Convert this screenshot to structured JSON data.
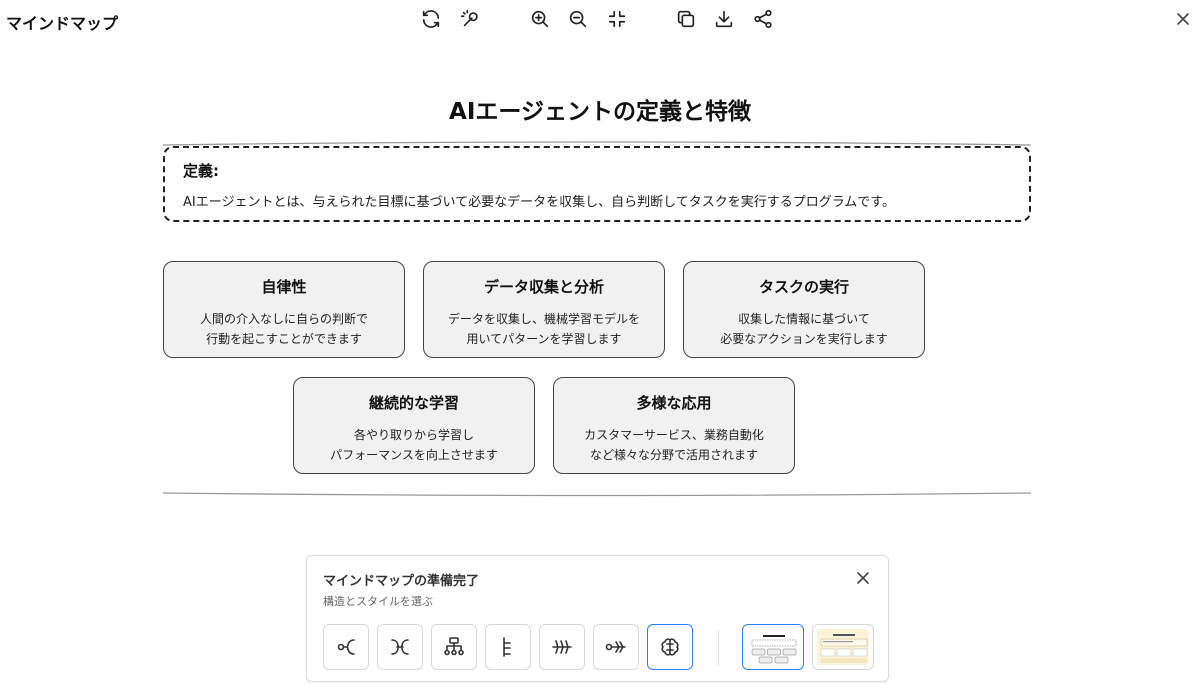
{
  "app": {
    "title": "マインドマップ"
  },
  "toolbar": {
    "icons": [
      "refresh-icon",
      "magic-wand-icon",
      "zoom-in-icon",
      "zoom-out-icon",
      "collapse-icon",
      "copy-icon",
      "download-icon",
      "share-icon"
    ]
  },
  "mindmap": {
    "title": "AIエージェントの定義と特徴",
    "definition": {
      "label": "定義:",
      "text": "AIエージェントとは、与えられた目標に基づいて必要なデータを収集し、自ら判断してタスクを実行するプログラムです。"
    },
    "cards": [
      {
        "title": "自律性",
        "lines": [
          "人間の介入なしに自らの判断で",
          "行動を起こすことができます"
        ]
      },
      {
        "title": "データ収集と分析",
        "lines": [
          "データを収集し、機械学習モデルを",
          "用いてパターンを学習します"
        ]
      },
      {
        "title": "タスクの実行",
        "lines": [
          "収集した情報に基づいて",
          "必要なアクションを実行します"
        ]
      },
      {
        "title": "継続的な学習",
        "lines": [
          "各やり取りから学習し",
          "パフォーマンスを向上させます"
        ]
      },
      {
        "title": "多様な応用",
        "lines": [
          "カスタマーサービス、業務自動化",
          "など様々な分野で活用されます"
        ]
      }
    ]
  },
  "panel": {
    "title": "マインドマップの準備完了",
    "subtitle": "構造とスタイルを選ぶ",
    "layouts": [
      "left-right-icon",
      "bidirectional-icon",
      "org-chart-icon",
      "tree-icon",
      "timeline-icon",
      "fishbone-icon",
      "brain-icon"
    ],
    "selected_layout": 6,
    "selected_style": 0
  },
  "colors": {
    "accent": "#2d7ff9",
    "card_bg": "#f1f1f1",
    "style2_bg": "#fbf3da"
  }
}
